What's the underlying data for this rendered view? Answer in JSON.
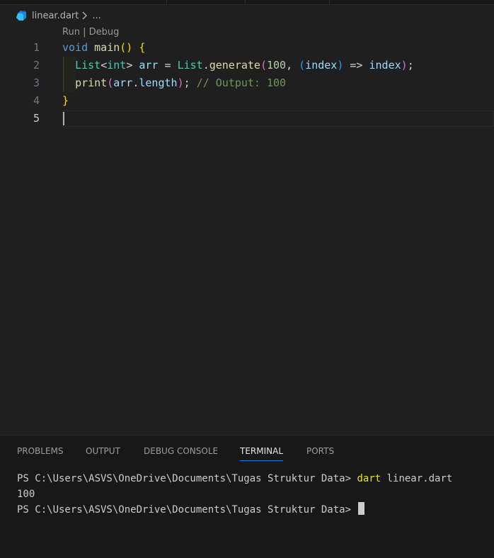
{
  "breadcrumb": {
    "file": "linear.dart",
    "more": "...",
    "file_icon": "dart-file-icon",
    "chevron_icon": "chevron-right-icon"
  },
  "codelens": {
    "run": "Run",
    "separator": " | ",
    "debug": "Debug"
  },
  "editor": {
    "line_numbers": [
      "1",
      "2",
      "3",
      "4",
      "5"
    ],
    "active_line": 5,
    "lines": [
      [
        {
          "t": "void",
          "c": "t-kw"
        },
        {
          "t": " ",
          "c": ""
        },
        {
          "t": "main",
          "c": "t-fn"
        },
        {
          "t": "()",
          "c": "t-br1"
        },
        {
          "t": " ",
          "c": ""
        },
        {
          "t": "{",
          "c": "t-br1"
        }
      ],
      [
        {
          "t": "  ",
          "c": ""
        },
        {
          "t": "List",
          "c": "t-type"
        },
        {
          "t": "<",
          "c": "t-op"
        },
        {
          "t": "int",
          "c": "t-type"
        },
        {
          "t": ">",
          "c": "t-op"
        },
        {
          "t": " ",
          "c": ""
        },
        {
          "t": "arr",
          "c": "t-var"
        },
        {
          "t": " = ",
          "c": "t-op"
        },
        {
          "t": "List",
          "c": "t-type"
        },
        {
          "t": ".",
          "c": "t-op"
        },
        {
          "t": "generate",
          "c": "t-fn"
        },
        {
          "t": "(",
          "c": "t-br2"
        },
        {
          "t": "100",
          "c": "t-num"
        },
        {
          "t": ", ",
          "c": "t-op"
        },
        {
          "t": "(",
          "c": "t-br3"
        },
        {
          "t": "index",
          "c": "t-var"
        },
        {
          "t": ")",
          "c": "t-br3"
        },
        {
          "t": " => ",
          "c": "t-op"
        },
        {
          "t": "index",
          "c": "t-var"
        },
        {
          "t": ")",
          "c": "t-br2"
        },
        {
          "t": ";",
          "c": "t-op"
        }
      ],
      [
        {
          "t": "  ",
          "c": ""
        },
        {
          "t": "print",
          "c": "t-fn"
        },
        {
          "t": "(",
          "c": "t-br2"
        },
        {
          "t": "arr",
          "c": "t-var"
        },
        {
          "t": ".",
          "c": "t-op"
        },
        {
          "t": "length",
          "c": "t-var"
        },
        {
          "t": ")",
          "c": "t-br2"
        },
        {
          "t": ";",
          "c": "t-op"
        },
        {
          "t": " ",
          "c": ""
        },
        {
          "t": "// Output: 100",
          "c": "t-cm"
        }
      ],
      [
        {
          "t": "}",
          "c": "t-br1"
        }
      ],
      []
    ]
  },
  "panel": {
    "tabs": [
      "PROBLEMS",
      "OUTPUT",
      "DEBUG CONSOLE",
      "TERMINAL",
      "PORTS"
    ],
    "active_tab": "TERMINAL"
  },
  "terminal": {
    "line1_prompt": "PS C:\\Users\\ASVS\\OneDrive\\Documents\\Tugas Struktur Data> ",
    "line1_cmd": "dart",
    "line1_args": " linear.dart",
    "line2_output": "100",
    "line3_prompt": "PS C:\\Users\\ASVS\\OneDrive\\Documents\\Tugas Struktur Data> "
  }
}
